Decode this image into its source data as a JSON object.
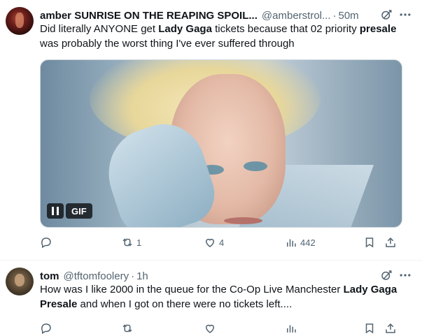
{
  "tweets": [
    {
      "name": "amber SUNRISE ON THE REAPING SPOIL...",
      "handle": "@amberstrol...",
      "time": "50m",
      "text_parts": [
        "Did literally ANYONE get ",
        "Lady Gaga",
        " tickets because that 02 priority ",
        "presale",
        " was probably the worst thing I've ever suffered through"
      ],
      "media_label": "GIF",
      "stats": {
        "replies": "",
        "reposts": "1",
        "likes": "4",
        "views": "442"
      }
    },
    {
      "name": "tom",
      "handle": "@tftomfoolery",
      "time": "1h",
      "text_parts": [
        "How was I like 2000 in the queue for the Co-Op Live Manchester ",
        "Lady Gaga Presale",
        " and when I got on there were no tickets left...."
      ],
      "stats": {
        "replies": "",
        "reposts": "",
        "likes": "",
        "views": ""
      }
    }
  ],
  "icons": {
    "reply": "reply-icon",
    "repost": "repost-icon",
    "like": "heart-icon",
    "views": "views-icon",
    "bookmark": "bookmark-icon",
    "share": "share-icon",
    "grok": "grok-icon",
    "more": "more-icon",
    "pause": "pause-icon"
  },
  "colors": {
    "text": "#0f1419",
    "muted": "#536471",
    "divider": "#eff3f4"
  }
}
